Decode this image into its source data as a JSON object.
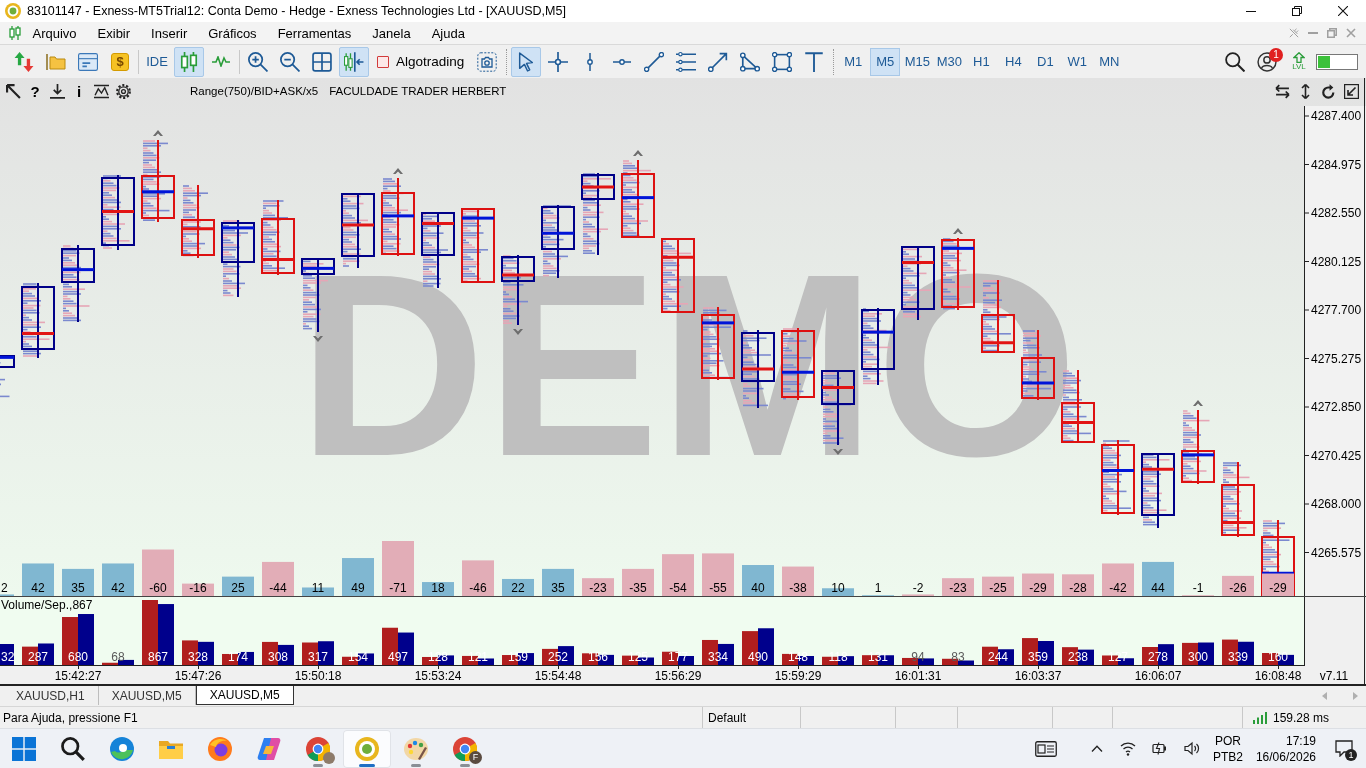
{
  "window": {
    "title": "83101147 - Exness-MT5Trial12: Conta Demo - Hedge - Exness Technologies Ltd - [XAUUSD,M5]"
  },
  "menu": [
    "Arquivo",
    "Exibir",
    "Inserir",
    "Gráficos",
    "Ferramentas",
    "Janela",
    "Ajuda"
  ],
  "toolbar": {
    "market_glyph": "$",
    "ide": "IDE",
    "chart_types": [
      {
        "selected": true
      },
      {
        "selected": false
      }
    ],
    "autoscroll": {
      "on": true
    },
    "algotrading": {
      "label": "Algotrading",
      "checked": false
    },
    "drawing_tools": [
      {
        "selected": true
      },
      {
        "selected": false
      },
      {
        "selected": false
      },
      {
        "selected": false
      },
      {
        "selected": false
      },
      {
        "selected": false
      },
      {
        "selected": false
      },
      {
        "selected": false
      },
      {
        "selected": false
      },
      {
        "selected": false
      }
    ],
    "timeframes": [
      {
        "label": "M1",
        "selected": false
      },
      {
        "label": "M5",
        "selected": true
      },
      {
        "label": "M15",
        "selected": false
      },
      {
        "label": "M30",
        "selected": false
      },
      {
        "label": "H1",
        "selected": false
      },
      {
        "label": "H4",
        "selected": false
      },
      {
        "label": "D1",
        "selected": false
      },
      {
        "label": "W1",
        "selected": false
      },
      {
        "label": "MN",
        "selected": false
      }
    ],
    "notification_count": "1",
    "level_label": "LVL"
  },
  "chart": {
    "help_glyph": "?",
    "info_glyph": "i",
    "indicator": "Range(750)/BID+ASK/x5",
    "caption": "FACULDADE TRADER HERBERT",
    "watermark": "DEMO",
    "price_axis": [
      "4287.400",
      "4284.975",
      "4282.550",
      "4280.125",
      "4277.700",
      "4275.275",
      "4272.850",
      "4270.425",
      "4268.000",
      "4265.575"
    ],
    "delta": {
      "values": [
        "2",
        "42",
        "35",
        "42",
        "-60",
        "-16",
        "25",
        "-44",
        "11",
        "49",
        "-71",
        "18",
        "-46",
        "22",
        "35",
        "-23",
        "-35",
        "-54",
        "-55",
        "40",
        "-38",
        "10",
        "1",
        "-2",
        "-23",
        "-25",
        "-29",
        "-28",
        "-42",
        "44",
        "-1",
        "-26",
        "-29"
      ]
    },
    "volume": {
      "label": "Volume/Sep.,867",
      "bar_labels": [
        "32",
        "287",
        "680",
        "68",
        "867",
        "328",
        "174",
        "308",
        "317",
        "154",
        "497",
        "128",
        "121",
        "159",
        "252",
        "156",
        "125",
        "177",
        "334",
        "490",
        "148",
        "118",
        "131",
        "94",
        "83",
        "244",
        "359",
        "238",
        "127",
        "278",
        "300",
        "339",
        "160"
      ]
    },
    "time_axis": [
      "15:42:27",
      "15:47:26",
      "15:50:18",
      "15:53:24",
      "15:54:48",
      "15:56:29",
      "15:59:29",
      "16:01:31",
      "16:03:37",
      "16:06:07",
      "16:08:48"
    ],
    "version": "v7.11"
  },
  "tabs": [
    {
      "label": "XAUUSD,H1",
      "selected": false
    },
    {
      "label": "XAUUSD,M5",
      "selected": false
    },
    {
      "label": "XAUUSD,M5",
      "selected": true
    }
  ],
  "status_bar": {
    "help": "Para Ajuda, pressione F1",
    "profile": "Default",
    "ping": "159.28 ms"
  },
  "taskbar": {
    "apps": [
      {
        "running": false,
        "selected": false
      },
      {
        "running": false,
        "selected": false
      },
      {
        "running": false,
        "selected": false
      },
      {
        "running": false,
        "selected": false
      },
      {
        "running": true,
        "selected": false
      },
      {
        "running": true,
        "selected": true
      },
      {
        "running": true,
        "selected": false
      },
      {
        "running": true,
        "selected": false,
        "badge": "F"
      }
    ],
    "language": "POR",
    "layout": "PTB2",
    "time": "17:19",
    "date": "16/06/2026",
    "notification_count": "1"
  }
}
